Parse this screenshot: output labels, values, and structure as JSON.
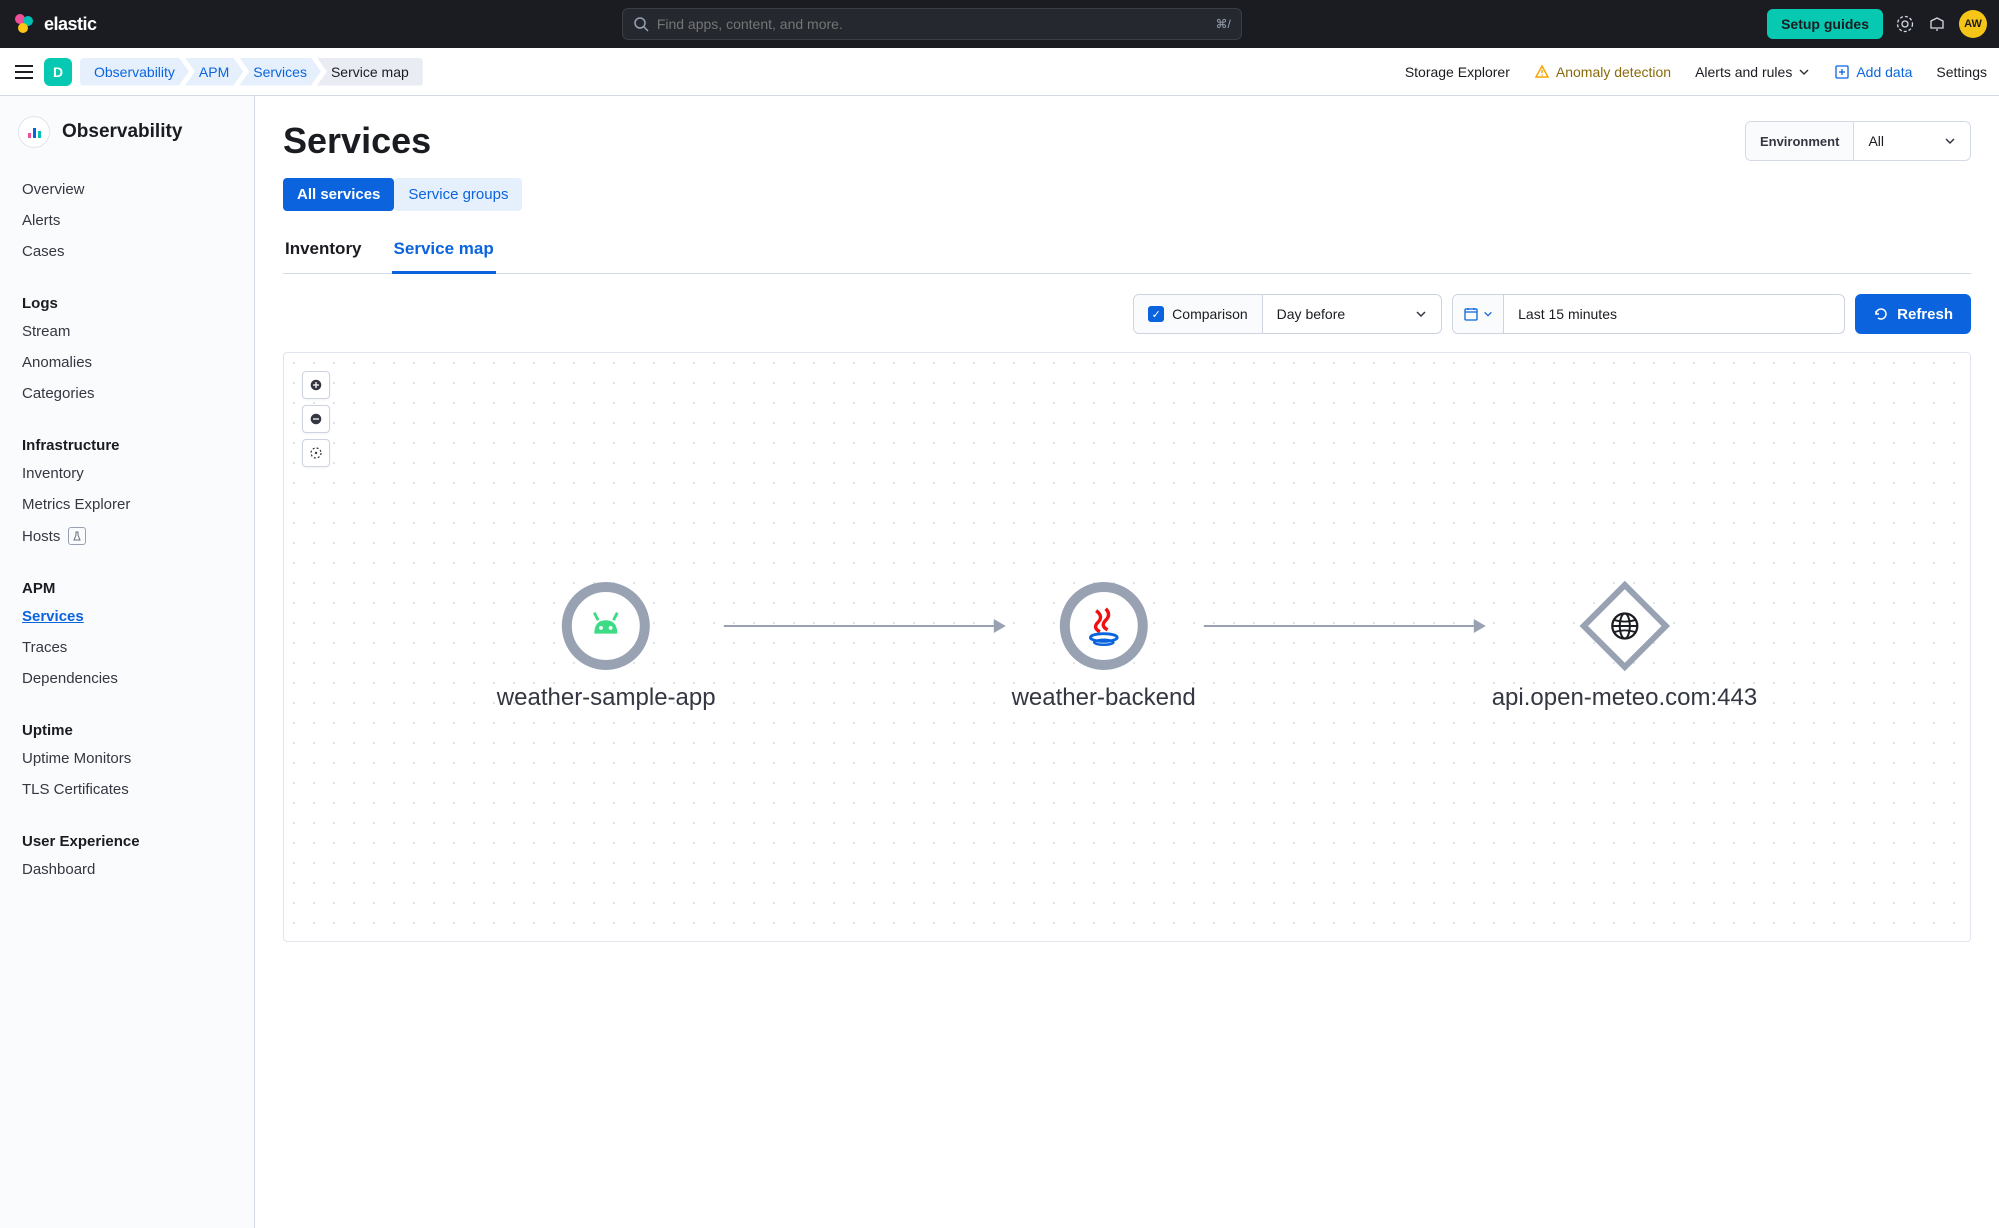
{
  "topbar": {
    "brand": "elastic",
    "search_placeholder": "Find apps, content, and more.",
    "search_shortcut": "⌘/",
    "setup_guides_button": "Setup guides",
    "avatar_initials": "AW"
  },
  "subheader": {
    "space": "D",
    "breadcrumbs": [
      "Observability",
      "APM",
      "Services",
      "Service map"
    ],
    "right_links": {
      "storage_explorer": "Storage Explorer",
      "anomaly_detection": "Anomaly detection",
      "alerts_and_rules": "Alerts and rules",
      "add_data": "Add data",
      "settings": "Settings"
    }
  },
  "sidebar": {
    "title": "Observability",
    "groups": [
      {
        "heading": null,
        "items": [
          "Overview",
          "Alerts",
          "Cases"
        ]
      },
      {
        "heading": "Logs",
        "items": [
          "Stream",
          "Anomalies",
          "Categories"
        ]
      },
      {
        "heading": "Infrastructure",
        "items": [
          "Inventory",
          "Metrics Explorer",
          "Hosts"
        ]
      },
      {
        "heading": "APM",
        "items": [
          "Services",
          "Traces",
          "Dependencies"
        ]
      },
      {
        "heading": "Uptime",
        "items": [
          "Uptime Monitors",
          "TLS Certificates"
        ]
      },
      {
        "heading": "User Experience",
        "items": [
          "Dashboard"
        ]
      }
    ],
    "active_item": "Services",
    "beta_items": [
      "Hosts"
    ]
  },
  "page": {
    "title": "Services",
    "environment_label": "Environment",
    "environment_value": "All",
    "pill_tabs": {
      "all_services": "All services",
      "service_groups": "Service groups",
      "active": "All services"
    },
    "line_tabs": {
      "inventory": "Inventory",
      "service_map": "Service map",
      "active": "Service map"
    },
    "controls": {
      "comparison_label": "Comparison",
      "comparison_value": "Day before",
      "time_range": "Last 15 minutes",
      "refresh": "Refresh"
    },
    "service_map": {
      "nodes": [
        {
          "id": "weather-sample-app",
          "label": "weather-sample-app",
          "kind": "android"
        },
        {
          "id": "weather-backend",
          "label": "weather-backend",
          "kind": "java"
        },
        {
          "id": "api.open-meteo.com:443",
          "label": "api.open-meteo.com:443",
          "kind": "external"
        }
      ],
      "edges": [
        {
          "from": "weather-sample-app",
          "to": "weather-backend"
        },
        {
          "from": "weather-backend",
          "to": "api.open-meteo.com:443"
        }
      ]
    }
  }
}
